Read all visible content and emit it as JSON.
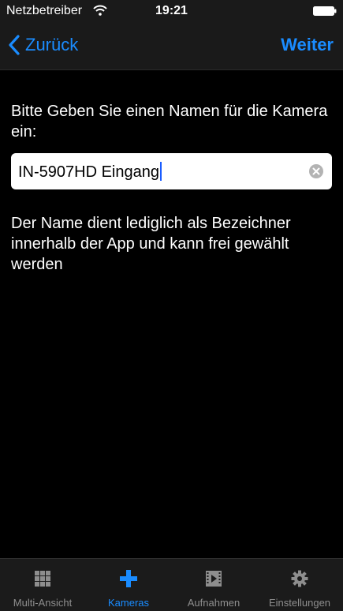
{
  "status_bar": {
    "carrier": "Netzbetreiber",
    "time": "19:21",
    "icons": [
      "wifi-icon",
      "battery-icon"
    ]
  },
  "nav": {
    "back_label": "Zurück",
    "next_label": "Weiter",
    "accent_color": "#1a8cff"
  },
  "content": {
    "prompt": "Bitte Geben Sie einen Namen für die Kamera ein:",
    "camera_name_value": "IN-5907HD Eingang",
    "help_text": "Der Name dient lediglich als Bezeichner innerhalb der App und kann frei gewählt werden"
  },
  "tabs": [
    {
      "label": "Multi-Ansicht",
      "icon": "grid-icon",
      "active": false
    },
    {
      "label": "Kameras",
      "icon": "plus-icon",
      "active": true
    },
    {
      "label": "Aufnahmen",
      "icon": "film-icon",
      "active": false
    },
    {
      "label": "Einstellungen",
      "icon": "gear-icon",
      "active": false
    }
  ]
}
